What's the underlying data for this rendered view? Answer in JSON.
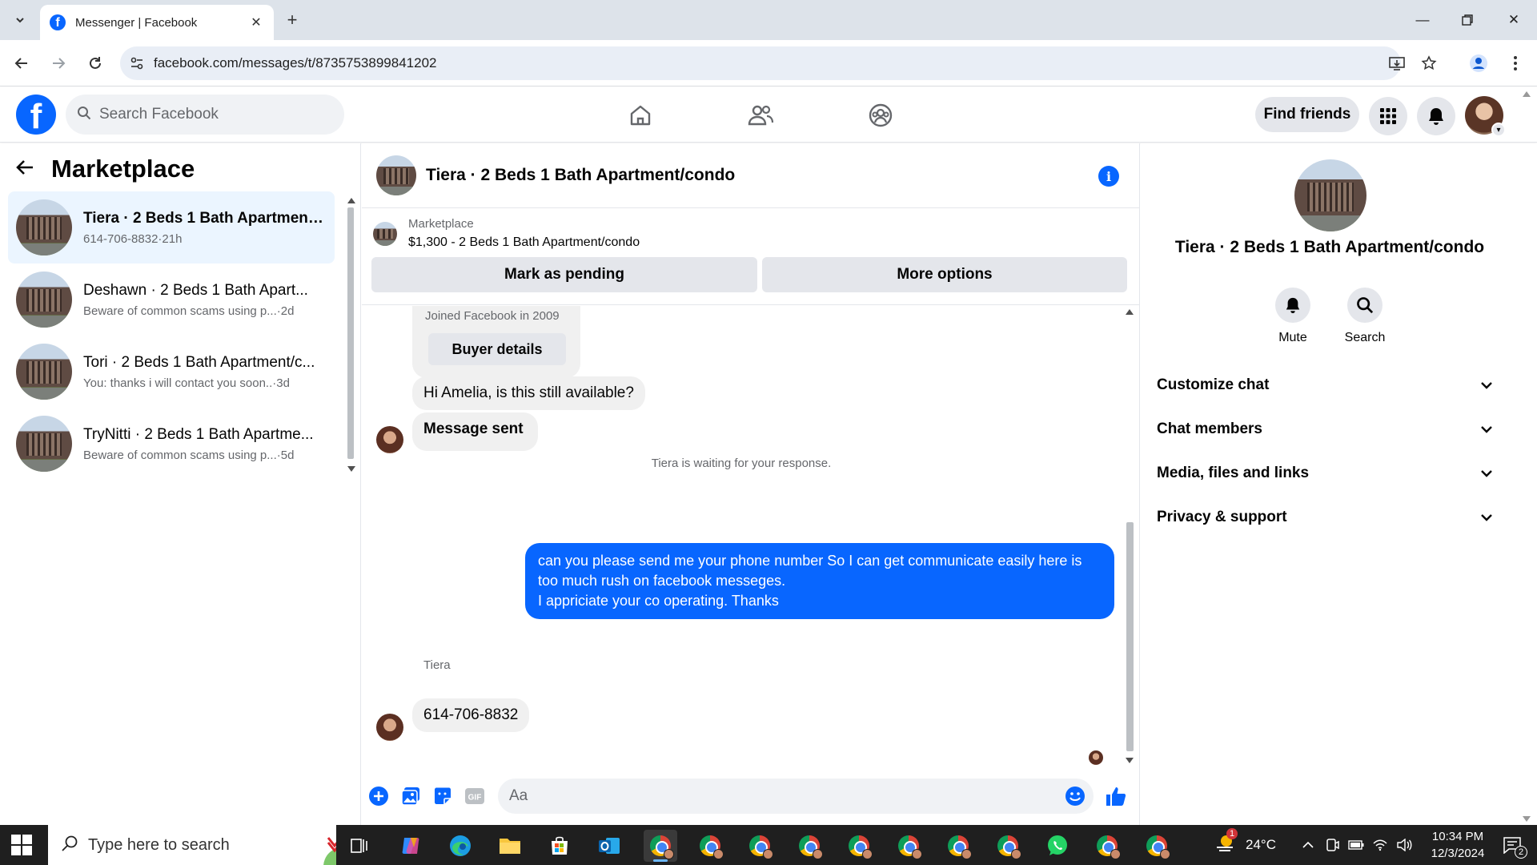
{
  "browser": {
    "tab_title": "Messenger | Facebook",
    "url": "facebook.com/messages/t/8735753899841202"
  },
  "fb_header": {
    "logo_letter": "f",
    "search_placeholder": "Search Facebook",
    "find_friends_label": "Find friends"
  },
  "left_panel": {
    "title": "Marketplace",
    "conversations": [
      {
        "name": "Tiera · 2 Beds 1 Bath Apartment...",
        "preview": "614-706-8832",
        "time": "·21h",
        "active": true
      },
      {
        "name": "Deshawn · 2 Beds 1 Bath Apart...",
        "preview": "Beware of common scams using p...",
        "time": "·2d",
        "active": false
      },
      {
        "name": "Tori · 2 Beds 1 Bath Apartment/c...",
        "preview": "You: thanks i will contact you soon..",
        "time": "·3d",
        "active": false
      },
      {
        "name": "TryNitti · 2 Beds 1 Bath Apartme...",
        "preview": "Beware of common scams using p...",
        "time": "·5d",
        "active": false
      }
    ]
  },
  "chat": {
    "title": "Tiera · 2 Beds 1 Bath Apartment/condo",
    "listing_label": "Marketplace",
    "listing_price": "$1,300 - 2 Beds 1 Bath Apartment/condo",
    "mark_pending_label": "Mark as pending",
    "more_options_label": "More options",
    "joined_text": "Joined Facebook in 2009",
    "buyer_details_label": "Buyer details",
    "msg_1": "Hi Amelia, is this still available?",
    "msg_2": "Message sent",
    "waiting_text": "Tiera is waiting for your response.",
    "outgoing_lines": [
      "can you please send me your phone number So I can get communicate easily here is too much rush on facebook messeges.",
      "I appriciate your co operating. Thanks"
    ],
    "sender_name": "Tiera",
    "msg_3": "614-706-8832",
    "input_placeholder": "Aa"
  },
  "right_panel": {
    "title": "Tiera · 2 Beds 1 Bath Apartment/condo",
    "mute_label": "Mute",
    "search_label": "Search",
    "sections": [
      "Customize chat",
      "Chat members",
      "Media, files and links",
      "Privacy & support"
    ]
  },
  "taskbar": {
    "search_placeholder": "Type here to search",
    "weather_badge": "1",
    "temperature": "24°C",
    "time": "10:34 PM",
    "date": "12/3/2024",
    "notification_count": "2"
  },
  "colors": {
    "fb_blue": "#0866ff",
    "active_conv_bg": "#ebf5ff",
    "bubble_gray": "#f0f0f0",
    "taskbar_bg": "#1f1f1f"
  }
}
